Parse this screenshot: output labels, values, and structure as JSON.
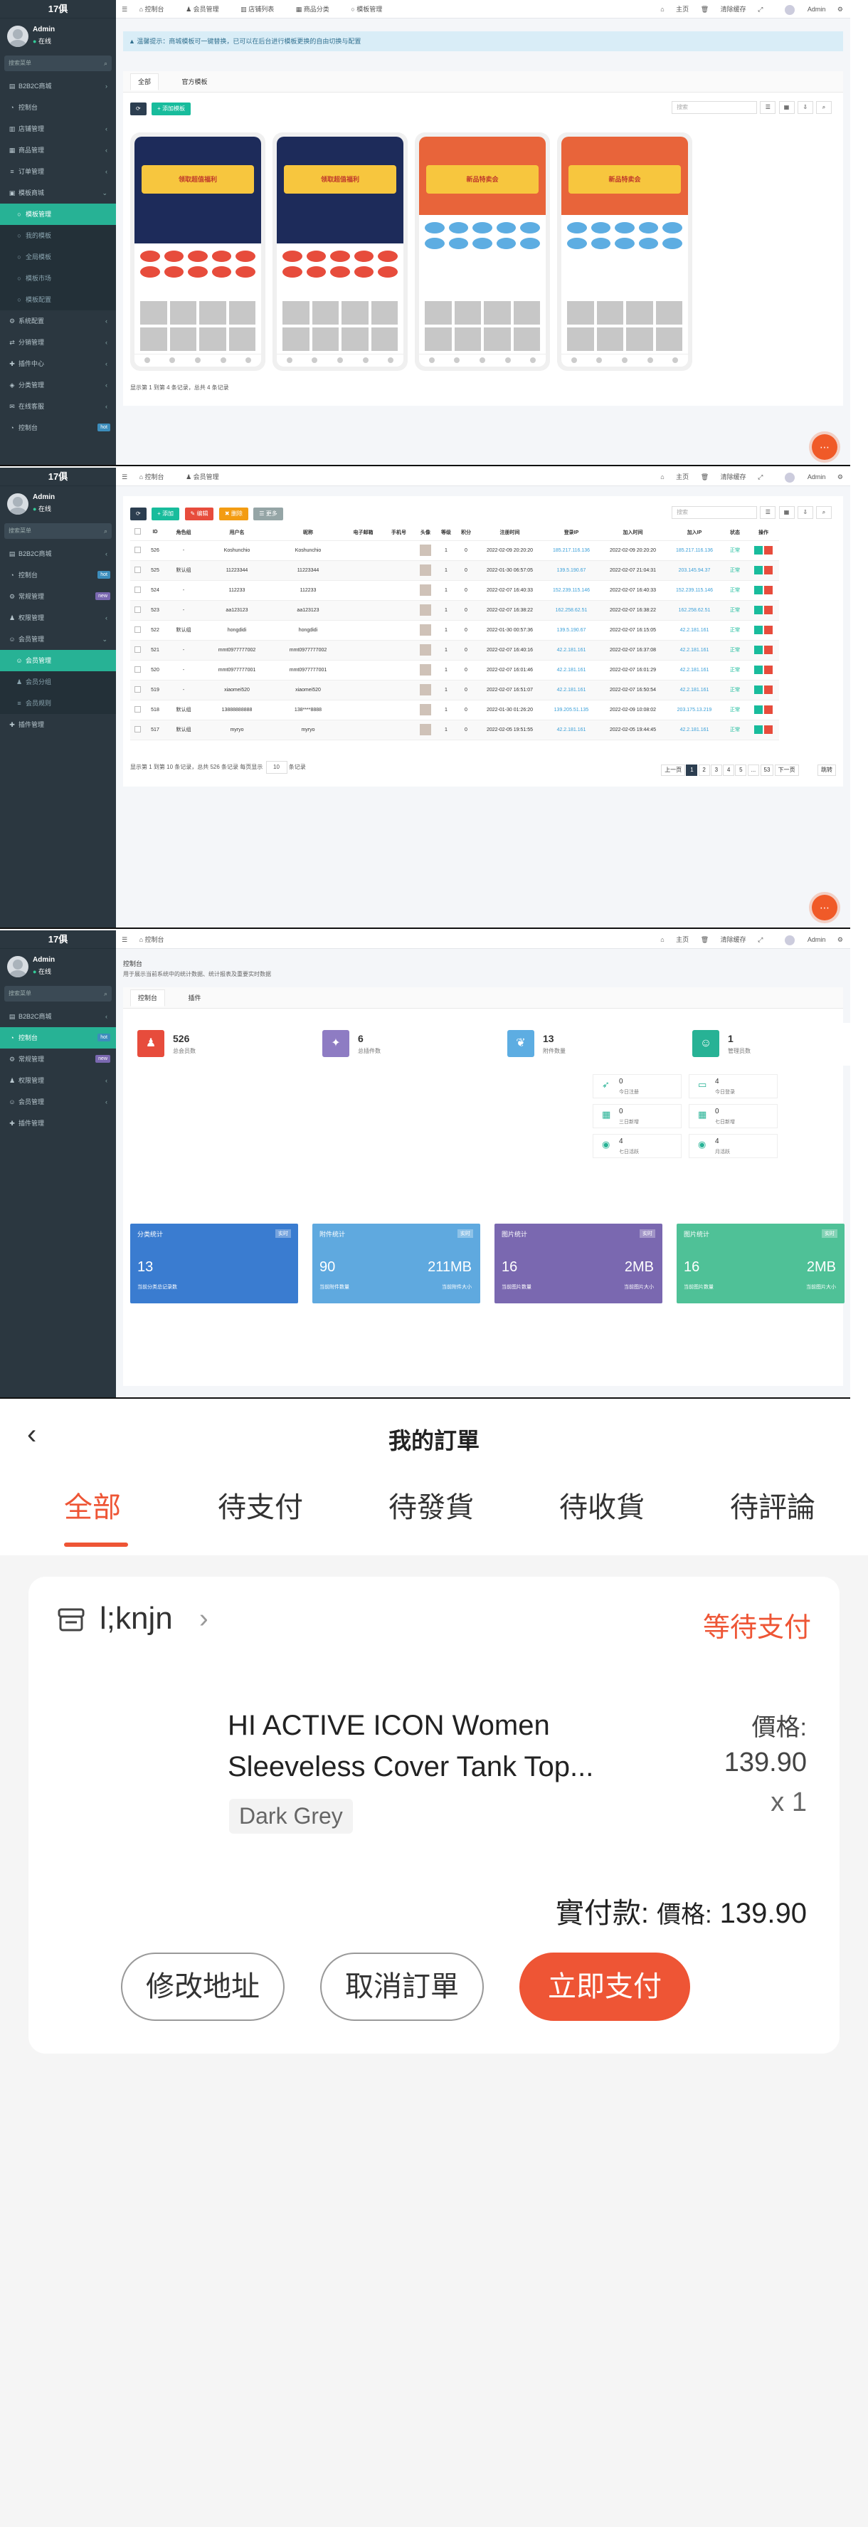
{
  "admin": {
    "brand": "17俱",
    "user": "Admin",
    "status": "在线",
    "search_placeholder": "搜索菜单",
    "topbar_right": [
      "主页",
      "清除缓存",
      "Admin"
    ],
    "colors": {
      "sidebar": "#2b3740",
      "active": "#27b295",
      "accent": "#f05a28"
    }
  },
  "panel1": {
    "top_tabs": [
      "控制台",
      "会员管理",
      "店铺列表",
      "商品分类",
      "模板管理"
    ],
    "sidebar": [
      "B2B2C商城",
      "控制台",
      "店铺管理",
      "商品管理",
      "订单管理",
      "模板商城",
      "模板管理",
      "我的模板",
      "全局模板",
      "模板市场",
      "模板配置",
      "系统配置",
      "分销管理",
      "插件中心",
      "分类管理",
      "在线客服",
      "控制台"
    ],
    "notice": "温馨提示：商城模板可一键替换，已可以在后台进行模板更换的自由切换与配置",
    "tabs": [
      "全部",
      "官方模板"
    ],
    "add_button": "添加模板",
    "search_placeholder": "搜索",
    "themes": [
      {
        "banner": "领取超值福利"
      },
      {
        "banner": "领取超值福利"
      },
      {
        "banner": "新品特卖会"
      },
      {
        "banner": "新品特卖会"
      }
    ],
    "summary": "显示第 1 到第 4 条记录，总共 4 条记录"
  },
  "panel2": {
    "top_tabs": [
      "控制台",
      "会员管理"
    ],
    "sidebar": [
      "B2B2C商城",
      "控制台",
      "常规管理",
      "权限管理",
      "会员管理",
      "会员管理",
      "会员分组",
      "会员规则",
      "插件管理"
    ],
    "buttons": [
      "添加",
      "编辑",
      "删除",
      "更多"
    ],
    "columns": [
      "ID",
      "角色组",
      "用户名",
      "昵称",
      "电子邮箱",
      "手机号",
      "头像",
      "等级",
      "积分",
      "注册时间",
      "登录IP",
      "加入时间",
      "加入IP",
      "状态",
      "操作"
    ],
    "rows": [
      [
        "526",
        "-",
        "Koshunchio",
        "Koshunchio",
        "",
        "",
        "",
        "1",
        "0",
        "2022-02-09 20:20:20",
        "185.217.116.136",
        "2022-02-09 20:20:20",
        "185.217.116.136",
        "正常"
      ],
      [
        "525",
        "默认组",
        "11223344",
        "11223344",
        "",
        "",
        "",
        "1",
        "0",
        "2022-01-30 06:57:05",
        "139.5.190.67",
        "2022-02-07 21:04:31",
        "203.145.94.37",
        "正常"
      ],
      [
        "524",
        "-",
        "112233",
        "112233",
        "",
        "",
        "",
        "1",
        "0",
        "2022-02-07 16:40:33",
        "152.239.115.146",
        "2022-02-07 16:40:33",
        "152.239.115.146",
        "正常"
      ],
      [
        "523",
        "-",
        "aa123123",
        "aa123123",
        "",
        "",
        "",
        "1",
        "0",
        "2022-02-07 16:38:22",
        "162.258.62.51",
        "2022-02-07 16:38:22",
        "162.258.62.51",
        "正常"
      ],
      [
        "522",
        "默认组",
        "hongdidi",
        "hongdidi",
        "",
        "",
        "",
        "1",
        "0",
        "2022-01-30 00:57:36",
        "139.5.190.67",
        "2022-02-07 16:15:05",
        "42.2.181.161",
        "正常"
      ],
      [
        "521",
        "-",
        "mmt0977777002",
        "mmt0977777002",
        "",
        "",
        "",
        "1",
        "0",
        "2022-02-07 16:40:16",
        "42.2.181.161",
        "2022-02-07 16:37:08",
        "42.2.181.161",
        "正常"
      ],
      [
        "520",
        "-",
        "mmt0977777001",
        "mmt0977777001",
        "",
        "",
        "",
        "1",
        "0",
        "2022-02-07 16:01:46",
        "42.2.181.161",
        "2022-02-07 16:01:29",
        "42.2.181.161",
        "正常"
      ],
      [
        "519",
        "-",
        "xiaomei520",
        "xiaomei520",
        "",
        "",
        "",
        "1",
        "0",
        "2022-02-07 16:51:07",
        "42.2.181.161",
        "2022-02-07 16:50:54",
        "42.2.181.161",
        "正常"
      ],
      [
        "518",
        "默认组",
        "13888888888",
        "138****8888",
        "",
        "",
        "",
        "1",
        "0",
        "2022-01-30 01:26:20",
        "139.205.51.135",
        "2022-02-09 10:08:02",
        "203.175.13.219",
        "正常"
      ],
      [
        "517",
        "默认组",
        "myryo",
        "myryo",
        "",
        "",
        "",
        "1",
        "0",
        "2022-02-05 19:51:55",
        "42.2.181.161",
        "2022-02-05 19:44:45",
        "42.2.181.161",
        "正常"
      ]
    ],
    "info": "显示第 1 到第 10 条记录，总共 526 条记录 每页显示",
    "page_size": "10",
    "info_suffix": "条记录",
    "pager": [
      "上一页",
      "1",
      "2",
      "3",
      "4",
      "5",
      "...",
      "53",
      "下一页"
    ],
    "goto": "跳转"
  },
  "panel3": {
    "top_tabs": [
      "控制台"
    ],
    "sidebar": [
      "B2B2C商城",
      "控制台",
      "常规管理",
      "权限管理",
      "会员管理",
      "插件管理"
    ],
    "title": "控制台",
    "desc": "用于展示当前系统中的统计数据、统计报表及重要实时数据",
    "tabs": [
      "控制台",
      "插件"
    ],
    "stats": [
      {
        "num": "526",
        "label": "总会员数",
        "color": "#e74c3c"
      },
      {
        "num": "6",
        "label": "总插件数",
        "color": "#8e7cc3"
      },
      {
        "num": "13",
        "label": "附件数量",
        "color": "#5dade2"
      },
      {
        "num": "1",
        "label": "管理员数",
        "color": "#27b295"
      }
    ],
    "minis": [
      {
        "num": "0",
        "label": "今日注册"
      },
      {
        "num": "4",
        "label": "今日登录"
      },
      {
        "num": "0",
        "label": "三日新增"
      },
      {
        "num": "0",
        "label": "七日新增"
      },
      {
        "num": "4",
        "label": "七日活跃"
      },
      {
        "num": "4",
        "label": "月活跃"
      }
    ],
    "cards": [
      {
        "title": "分类统计",
        "badge": "实时",
        "n1": "13",
        "n2": "",
        "l1": "当前分类总记录数",
        "l2": "",
        "color": "#3a7cd0"
      },
      {
        "title": "附件统计",
        "badge": "实时",
        "n1": "90",
        "n2": "211MB",
        "l1": "当前附件数量",
        "l2": "当前附件大小",
        "color": "#5fa9df"
      },
      {
        "title": "图片统计",
        "badge": "实时",
        "n1": "16",
        "n2": "2MB",
        "l1": "当前图片数量",
        "l2": "当前图片大小",
        "color": "#7a68b0"
      },
      {
        "title": "图片统计",
        "badge": "实时",
        "n1": "16",
        "n2": "2MB",
        "l1": "当前图片数量",
        "l2": "当前图片大小",
        "color": "#4fc197"
      }
    ]
  },
  "mobile": {
    "title": "我的訂單",
    "tabs": [
      "全部",
      "待支付",
      "待發貨",
      "待收貨",
      "待評論"
    ],
    "shop": "l;knjn",
    "status": "等待支付",
    "product_name": "HI ACTIVE ICON Women Sleeveless Cover Tank Top...",
    "variant": "Dark Grey",
    "price_label": "價格:",
    "price": "139.90",
    "qty": "x 1",
    "paid_label": "實付款:",
    "paid_small": "價格:",
    "paid_value": "139.90",
    "buttons": [
      "修改地址",
      "取消訂單",
      "立即支付"
    ],
    "accent": "#ee5535"
  }
}
